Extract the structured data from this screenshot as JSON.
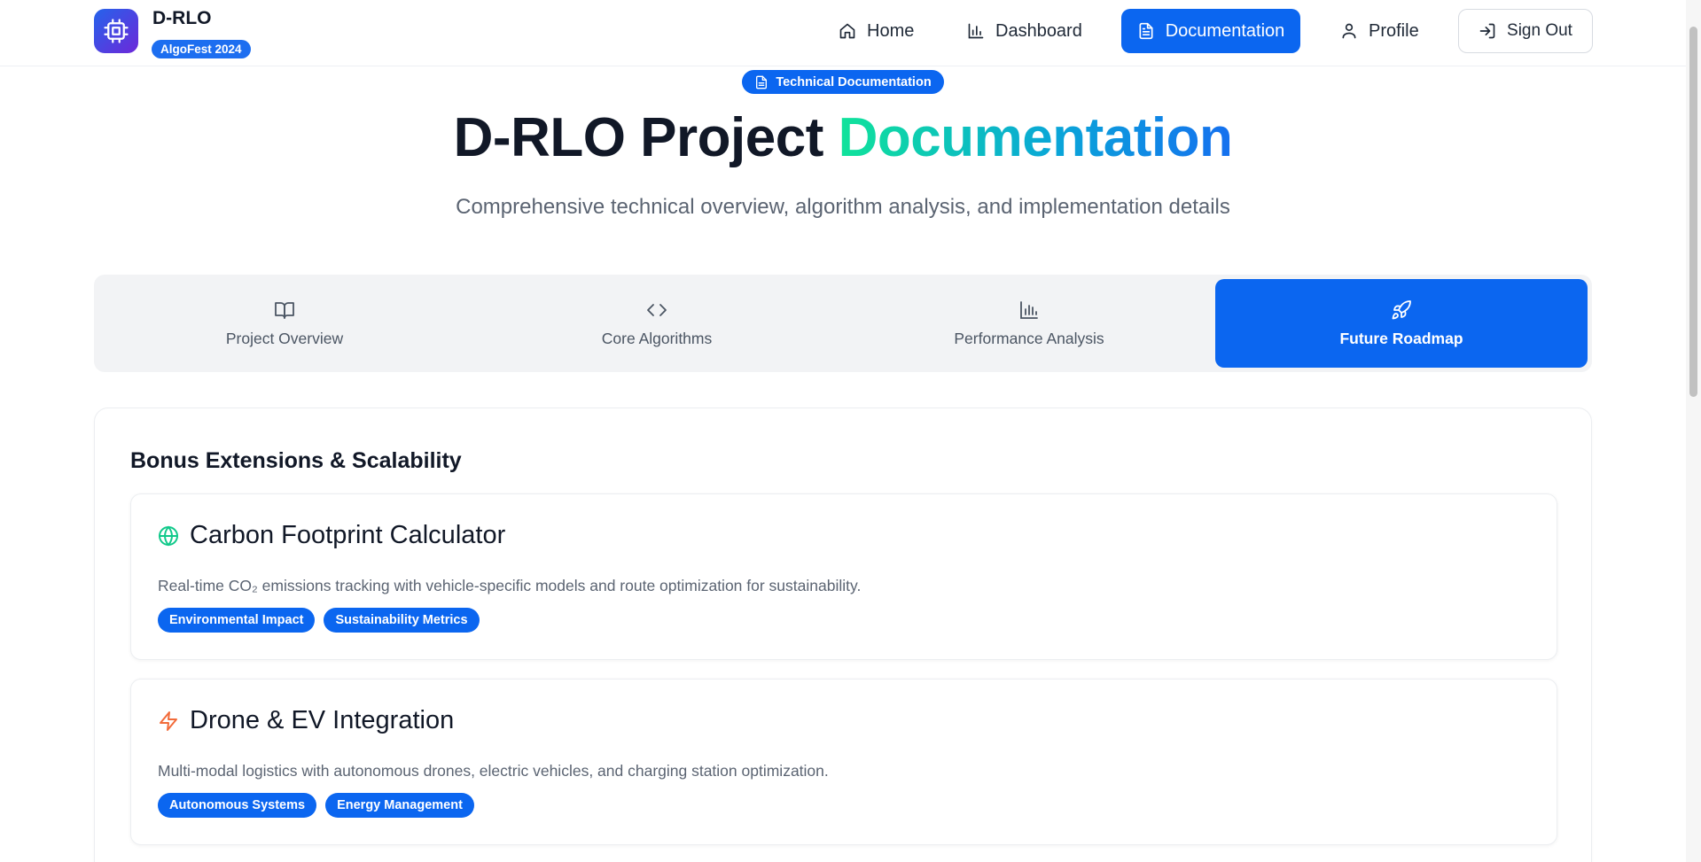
{
  "brand": {
    "name": "D-RLO",
    "badge": "AlgoFest 2024",
    "icon": "cpu-icon"
  },
  "nav": {
    "home": "Home",
    "dashboard": "Dashboard",
    "documentation": "Documentation",
    "profile": "Profile",
    "sign_out": "Sign Out"
  },
  "hero": {
    "badge": "Technical Documentation",
    "title_plain": "D-RLO Project",
    "title_highlight": "Documentation",
    "subtitle": "Comprehensive technical overview, algorithm analysis, and implementation details"
  },
  "tabs": [
    {
      "label": "Project Overview",
      "icon": "book-open-icon",
      "active": false
    },
    {
      "label": "Core Algorithms",
      "icon": "code-icon",
      "active": false
    },
    {
      "label": "Performance Analysis",
      "icon": "bar-chart-icon",
      "active": false
    },
    {
      "label": "Future Roadmap",
      "icon": "rocket-icon",
      "active": true
    }
  ],
  "section": {
    "title": "Bonus Extensions & Scalability",
    "features": [
      {
        "title": "Carbon Footprint Calculator",
        "icon": "globe-icon",
        "description": "Real-time CO₂ emissions tracking with vehicle-specific models and route optimization for sustainability.",
        "tags": [
          "Environmental Impact",
          "Sustainability Metrics"
        ]
      },
      {
        "title": "Drone & EV Integration",
        "icon": "lightning-icon",
        "description": "Multi-modal logistics with autonomous drones, electric vehicles, and charging station optimization.",
        "tags": [
          "Autonomous Systems",
          "Energy Management"
        ]
      }
    ]
  },
  "colors": {
    "primary": "#0b66f0",
    "globe_icon": "#10c98a",
    "lightning_icon": "#f26b3a"
  }
}
